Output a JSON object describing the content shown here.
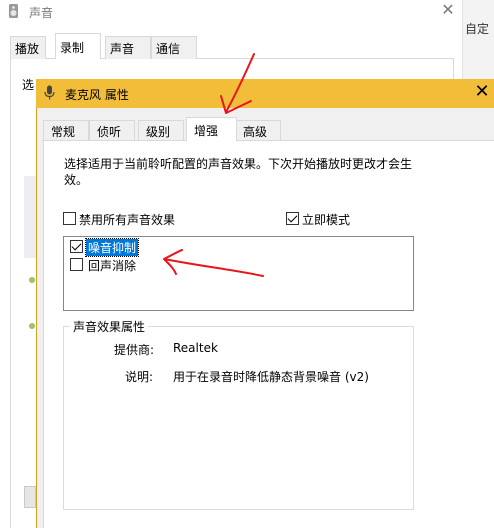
{
  "back_window": {
    "title": "声音",
    "tabs": [
      "播放",
      "录制",
      "声音",
      "通信"
    ],
    "active_tab": 1,
    "select_text": "选",
    "close_glyph": "✕"
  },
  "right_fragment": {
    "text": "自定"
  },
  "dialog": {
    "title": "麦克风 属性",
    "close_glyph": "✕",
    "tabs": [
      "常规",
      "侦听",
      "级别",
      "增强",
      "高级"
    ],
    "active_tab": 3,
    "description": "选择适用于当前聆听配置的声音效果。下次开始播放时更改才会生效。",
    "disable_all": {
      "label": "禁用所有声音效果",
      "checked": false
    },
    "immediate_mode": {
      "label": "立即模式",
      "checked": true
    },
    "effects": [
      {
        "label": "噪音抑制",
        "checked": true,
        "selected": true
      },
      {
        "label": "回声消除",
        "checked": false,
        "selected": false
      }
    ],
    "properties": {
      "title": "声音效果属性",
      "provider_label": "提供商:",
      "provider_value": "Realtek",
      "description_label": "说明:",
      "description_value": "用于在录音时降低静态背景噪音 (v2)"
    }
  },
  "colors": {
    "dialog_titlebar": "#f2bd38",
    "selection": "#0078d7",
    "annotation": "#e8151b"
  },
  "icons": {
    "back_app": "speaker-icon",
    "dialog_app": "microphone-icon"
  }
}
